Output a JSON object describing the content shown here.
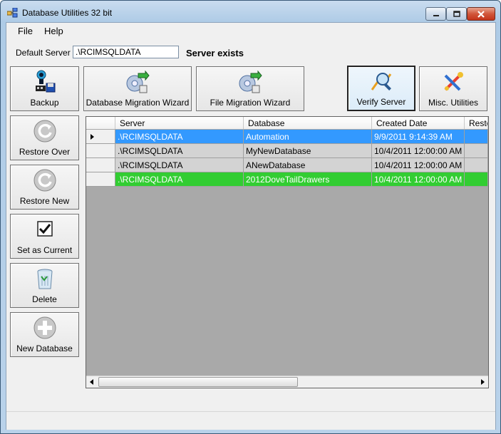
{
  "window": {
    "title": "Database Utilities 32 bit"
  },
  "menu": [
    {
      "label": "File"
    },
    {
      "label": "Help"
    }
  ],
  "server": {
    "label": "Default Server",
    "value": ".\\RCIMSQLDATA",
    "status": "Server exists"
  },
  "toolbar": {
    "backup": "Backup",
    "db_migration": "Database Migration Wizard",
    "file_migration": "File Migration Wizard",
    "verify_server": "Verify Server",
    "misc_utilities": "Misc. Utilities"
  },
  "sidebar": {
    "restore_over": "Restore Over",
    "restore_new": "Restore New",
    "set_current": "Set as Current",
    "delete": "Delete",
    "new_database": "New Database"
  },
  "grid": {
    "columns": [
      "Server",
      "Database",
      "Created Date",
      "Resto"
    ],
    "rows": [
      {
        "server": ".\\RCIMSQLDATA",
        "database": "Automation",
        "created": "9/9/2011 9:14:39 AM",
        "state": "selected"
      },
      {
        "server": ".\\RCIMSQLDATA",
        "database": "MyNewDatabase",
        "created": "10/4/2011 12:00:00 AM",
        "state": "normal"
      },
      {
        "server": ".\\RCIMSQLDATA",
        "database": "ANewDatabase",
        "created": "10/4/2011 12:00:00 AM",
        "state": "normal"
      },
      {
        "server": ".\\RCIMSQLDATA",
        "database": "2012DoveTailDrawers",
        "created": "10/4/2011 12:00:00 AM",
        "state": "current"
      }
    ]
  },
  "colors": {
    "selected_row": "#3399ff",
    "current_row": "#32cd32",
    "normal_row": "#d3d3d3",
    "grid_background": "#a9a9a9"
  }
}
